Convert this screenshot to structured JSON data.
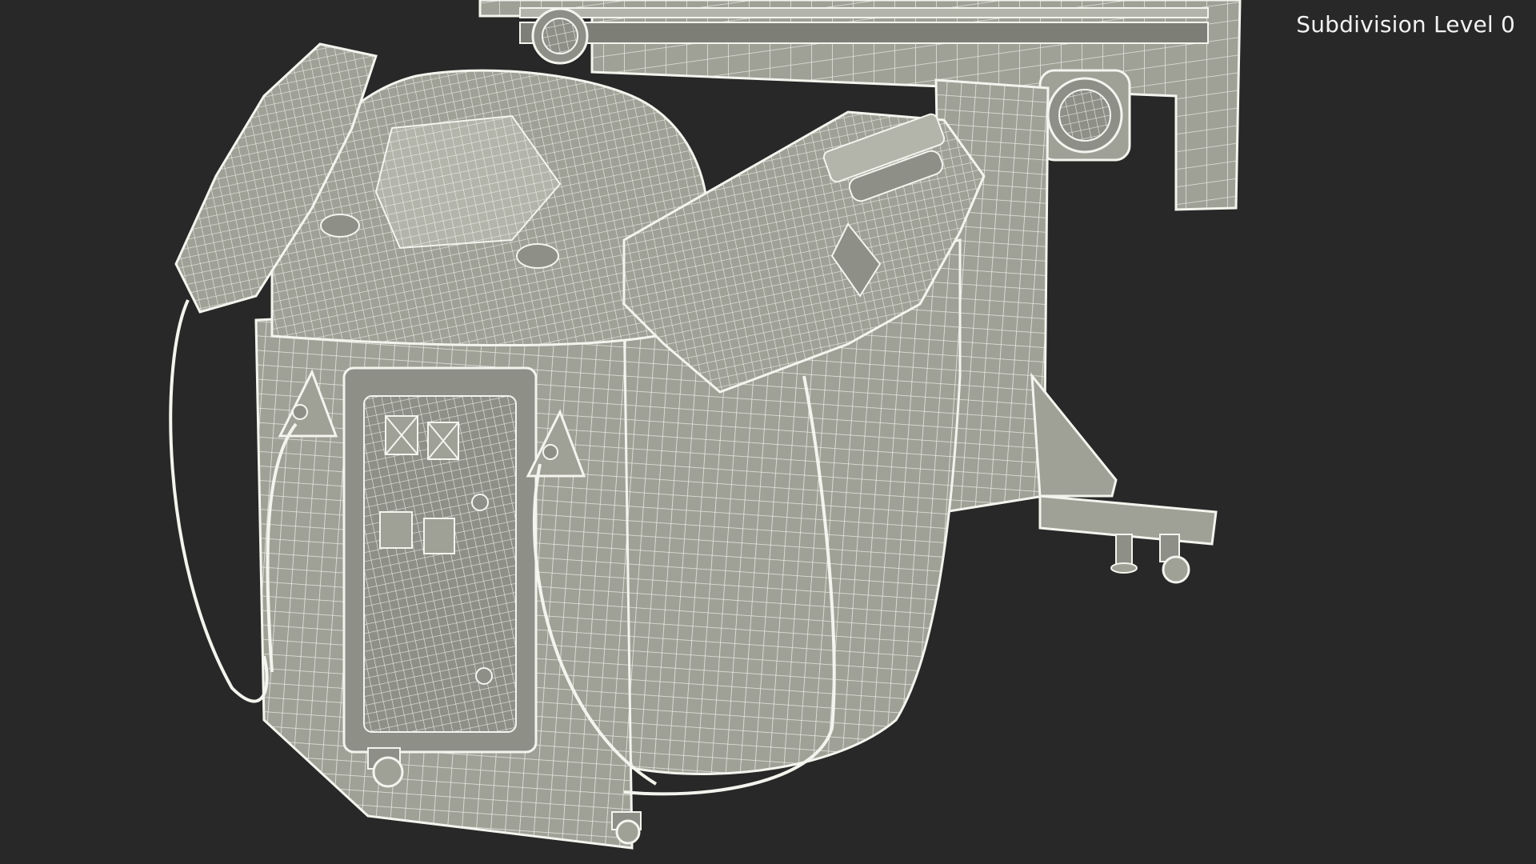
{
  "overlay": {
    "subdivision_label": "Subdivision Level 0"
  },
  "colors": {
    "background": "#282828",
    "surface": "#9fa096",
    "surface_light": "#b3b4aa",
    "surface_dark": "#7d7e75",
    "wire": "#f4f4ee",
    "label_text": "#f2f2f2"
  },
  "scene": {
    "subject": "arcade-gun-cabinet-wireframe"
  }
}
